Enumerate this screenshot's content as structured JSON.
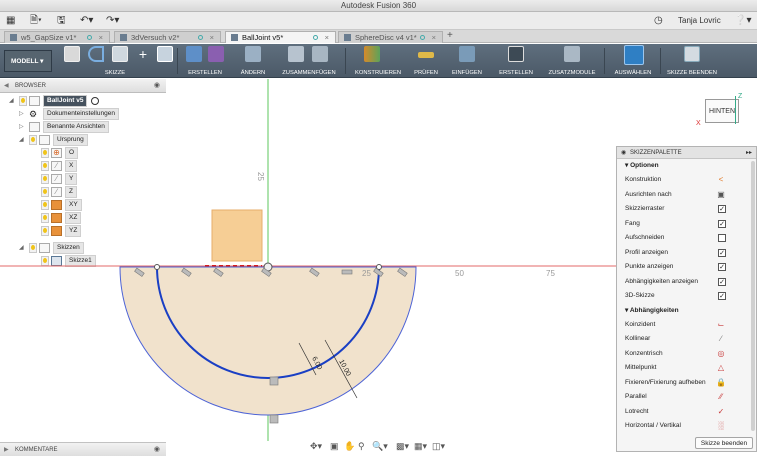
{
  "app": {
    "title": "Autodesk Fusion 360"
  },
  "quick_access": {
    "grid_icon": "app-grid-icon",
    "file_icon": "file-icon",
    "save_icon": "save-icon",
    "undo_icon": "undo-icon",
    "redo_icon": "redo-icon",
    "clock_icon": "job-status-icon",
    "user_name": "Tanja Lovric",
    "help_icon": "help-icon"
  },
  "tabs": [
    {
      "label": "w5_GapSize v1*",
      "active": false
    },
    {
      "label": "3dVersuch v2*",
      "active": false
    },
    {
      "label": "BallJoint v5*",
      "active": true
    },
    {
      "label": "SphereDisc v4 v1*",
      "active": false
    }
  ],
  "ribbon": {
    "workspace": "MODELL",
    "groups": [
      {
        "label": "SKIZZE"
      },
      {
        "label": "ERSTELLEN"
      },
      {
        "label": "ÄNDERN"
      },
      {
        "label": "ZUSAMMENFÜGEN"
      },
      {
        "label": "KONSTRUIEREN"
      },
      {
        "label": "PRÜFEN"
      },
      {
        "label": "EINFÜGEN"
      },
      {
        "label": "ERSTELLEN"
      },
      {
        "label": "ZUSATZMODULE"
      },
      {
        "label": "AUSWÄHLEN"
      },
      {
        "label": "SKIZZE BEENDEN"
      }
    ]
  },
  "browser": {
    "title": "BROWSER",
    "nodes": [
      {
        "label": "BallJoint v5"
      },
      {
        "label": "Dokumenteinstellungen"
      },
      {
        "label": "Benannte Ansichten"
      },
      {
        "label": "Ursprung"
      },
      {
        "label": "O"
      },
      {
        "label": "X"
      },
      {
        "label": "Y"
      },
      {
        "label": "Z"
      },
      {
        "label": "XY"
      },
      {
        "label": "XZ"
      },
      {
        "label": "YZ"
      },
      {
        "label": "Skizzen"
      },
      {
        "label": "Skizze1"
      }
    ]
  },
  "comments": {
    "title": "KOMMENTARE"
  },
  "viewcube": {
    "face": "HINTEN",
    "axis_x": "X",
    "axis_z": "Z"
  },
  "canvas": {
    "ruler_labels": [
      "25",
      "25",
      "50",
      "75"
    ],
    "dimension_small": "6.00",
    "dimension_large": "10.00"
  },
  "palette": {
    "title": "SKIZZENPALETTE",
    "options_title": "Optionen",
    "options": [
      {
        "label": "Konstruktion",
        "checked": null
      },
      {
        "label": "Ausrichten nach",
        "checked": null
      },
      {
        "label": "Skizzierraster",
        "checked": true
      },
      {
        "label": "Fang",
        "checked": true
      },
      {
        "label": "Aufschneiden",
        "checked": false
      },
      {
        "label": "Profil anzeigen",
        "checked": true
      },
      {
        "label": "Punkte anzeigen",
        "checked": true
      },
      {
        "label": "Abhängigkeiten anzeigen",
        "checked": true
      },
      {
        "label": "3D-Skizze",
        "checked": true
      }
    ],
    "constraints_title": "Abhängigkeiten",
    "constraints": [
      {
        "label": "Koinzident",
        "icon": "coincident-icon"
      },
      {
        "label": "Kollinear",
        "icon": "collinear-icon"
      },
      {
        "label": "Konzentrisch",
        "icon": "concentric-icon"
      },
      {
        "label": "Mittelpunkt",
        "icon": "midpoint-icon"
      },
      {
        "label": "Fixieren/Fixierung aufheben",
        "icon": "lock-icon"
      },
      {
        "label": "Parallel",
        "icon": "parallel-icon"
      },
      {
        "label": "Lotrecht",
        "icon": "perpendicular-icon"
      },
      {
        "label": "Horizontal / Vertikal",
        "icon": "horizontal-vertical-icon"
      }
    ],
    "finish_button": "Skizze beenden"
  },
  "colors": {
    "ribbon": "#56646f",
    "profile_fill": "#f1e2cc",
    "sketch_line": "#1a3fc4",
    "axis_red": "#e05555",
    "axis_green": "#57c457"
  }
}
